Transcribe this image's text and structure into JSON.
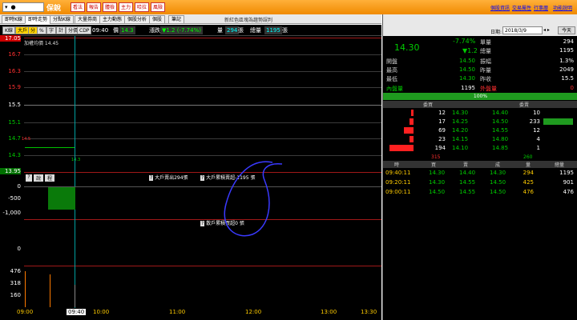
{
  "topbar": {
    "stock_name": "保銳",
    "buttons": [
      "看法",
      "報告",
      "體檢",
      "主力",
      "哈拉",
      "風險"
    ],
    "links": [
      "個股資訊",
      "交易屬性",
      "行事曆",
      "功能說明"
    ]
  },
  "tabs": [
    "即時K線",
    "即時走勢",
    "分點K線",
    "大量券商",
    "主力動態",
    "個股分析",
    "個股",
    "筆記"
  ],
  "notice": "新紅色區塊為趨勢誤判",
  "toolbar": {
    "buttons": [
      "K線",
      "大戶",
      "分",
      "%",
      "字",
      "計",
      "分價",
      "CDP"
    ],
    "time": "09:40",
    "price_label": "價",
    "price": "14.3",
    "change_label": "漲跌",
    "change": "▼1.2 (-7.74%)",
    "vol_label": "量",
    "vol": "294",
    "vol_unit": "張",
    "total_label": "總量",
    "total": "1195",
    "total_unit": "張"
  },
  "chart": {
    "prev_close_label": "加權均價 14.45",
    "y_labels": [
      "17.05",
      "16.7",
      "16.3",
      "15.9",
      "15.5",
      "15.1",
      "14.7",
      "14.3",
      "13.95"
    ],
    "small_label_high": "14.5",
    "small_label_low": "14.3",
    "mid_buttons": [
      "?",
      "說",
      "程"
    ],
    "y2_labels": [
      "0",
      "-500",
      "-1,000",
      "0"
    ],
    "vol_labels": [
      "476",
      "318",
      "160"
    ],
    "x_labels": [
      "09:00",
      "09:40",
      "10:00",
      "11:00",
      "12:00",
      "13:00",
      "13:30"
    ],
    "annotations": [
      "大戶賣出294張",
      "大戶累積賣超-1195 張",
      "散戶累積買超0 張"
    ],
    "colors": {
      "up": "#ff3030",
      "down": "#00c000",
      "grid": "#3a3a3a",
      "cursor": "#00ffff"
    }
  },
  "rightpanel": {
    "date_label": "日期:",
    "date": "2018/3/9",
    "today_button": "今天",
    "price": "14.30",
    "pct": "-7.74%",
    "chg": "▼1.2",
    "l_labels": [
      "單量",
      "總量"
    ],
    "l_values": [
      "294",
      "1195"
    ],
    "stats_left": [
      [
        "開盤",
        "14.50"
      ],
      [
        "最高",
        "14.50"
      ],
      [
        "最低",
        "14.30"
      ],
      [
        "內盤量",
        "1195"
      ]
    ],
    "stats_right": [
      [
        "振幅",
        "1.3%"
      ],
      [
        "昨量",
        "2049"
      ],
      [
        "昨收",
        "15.5"
      ],
      [
        "外盤量",
        "0"
      ]
    ],
    "pct100": "100%",
    "book_hdr": [
      "委買",
      "委賣"
    ],
    "book": [
      [
        "12",
        "14.30",
        "14.40",
        "10"
      ],
      [
        "17",
        "14.25",
        "14.50",
        "233"
      ],
      [
        "69",
        "14.20",
        "14.55",
        "12"
      ],
      [
        "23",
        "14.15",
        "14.80",
        "4"
      ],
      [
        "194",
        "14.10",
        "14.85",
        "1"
      ]
    ],
    "book_totals": [
      "315",
      "260"
    ],
    "tick_hdr": [
      "時",
      "買",
      "賣",
      "成",
      "量",
      "總量"
    ],
    "ticks": [
      [
        "09:40:11",
        "14.30",
        "14.40",
        "14.30",
        "294",
        "1195"
      ],
      [
        "09:20:11",
        "14.30",
        "14.55",
        "14.50",
        "425",
        "901"
      ],
      [
        "09:00:11",
        "14.50",
        "14.55",
        "14.50",
        "476",
        "476"
      ]
    ]
  }
}
